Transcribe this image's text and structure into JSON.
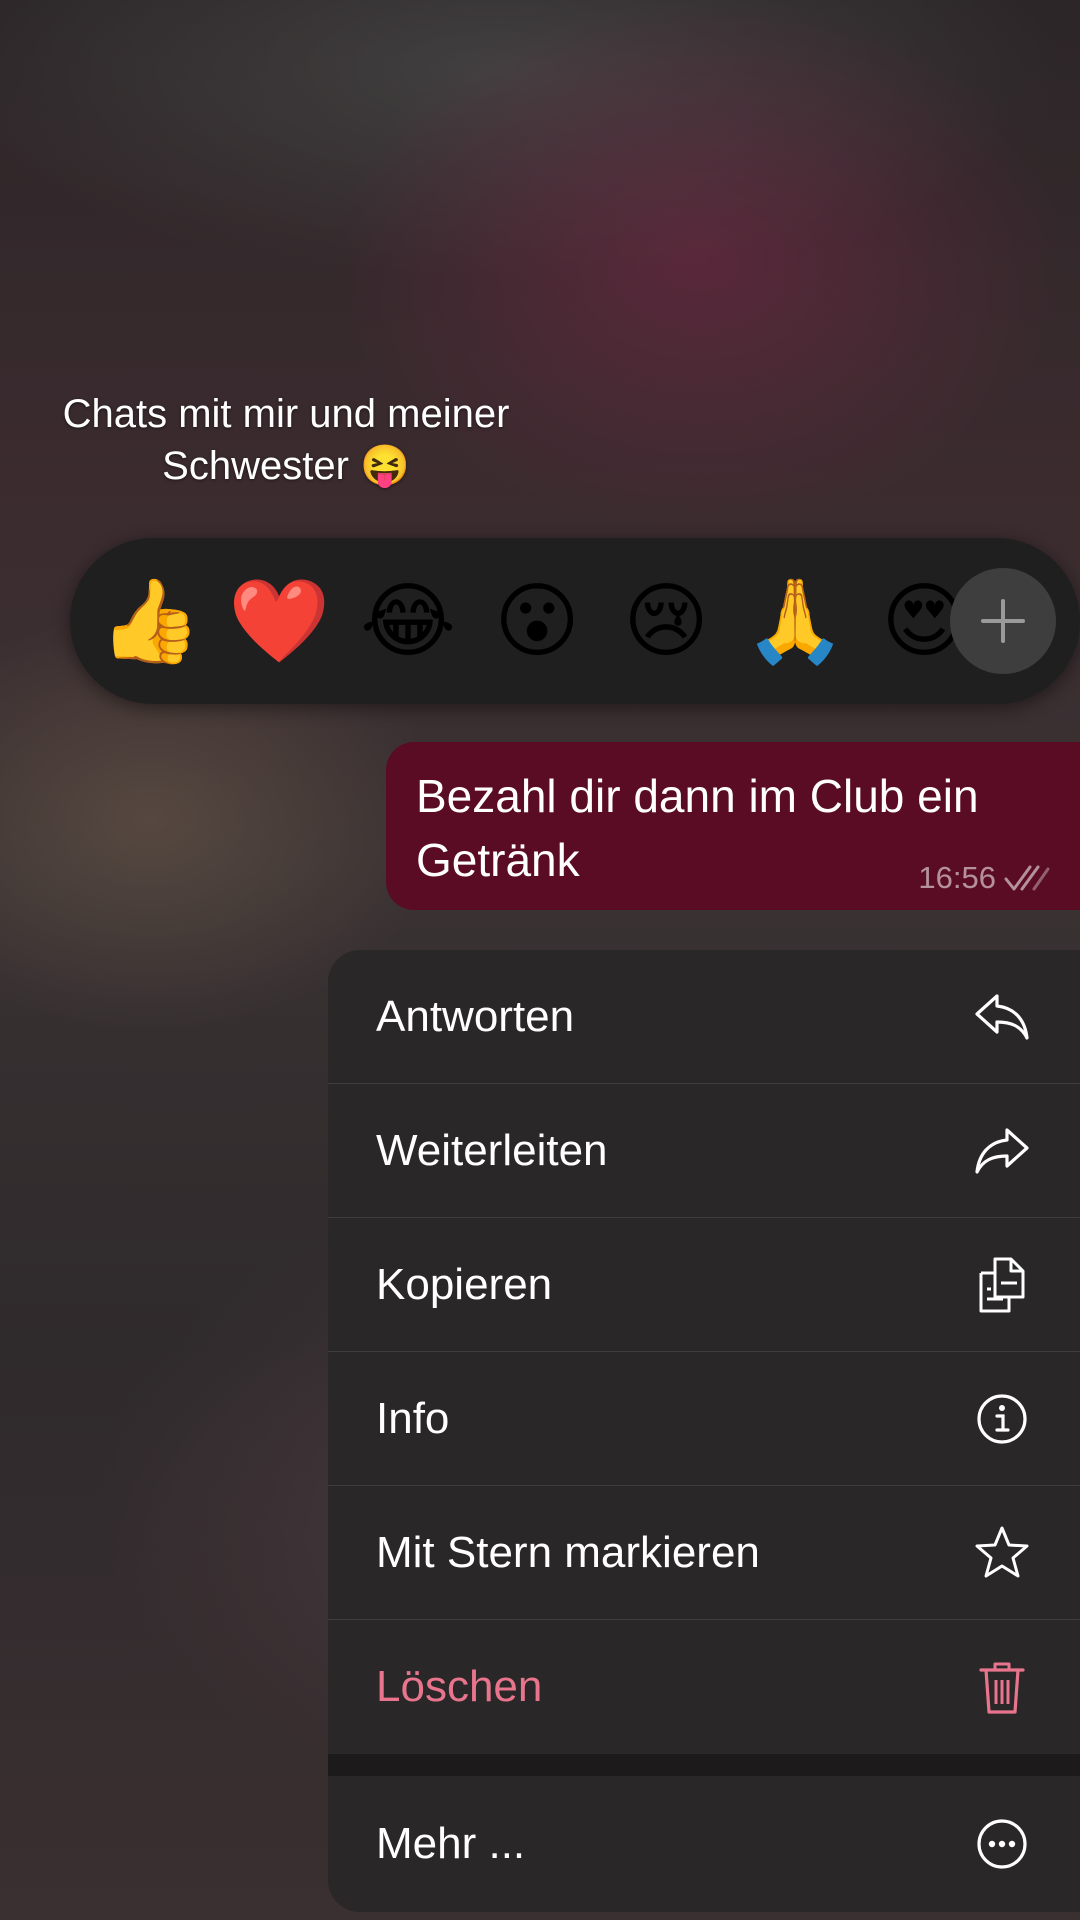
{
  "overlay": {
    "caption_line1": "Chats mit mir und meiner",
    "caption_line2": "Schwester 😝"
  },
  "reactions": {
    "emojis": [
      {
        "name": "thumbs-up",
        "glyph": "👍"
      },
      {
        "name": "red-heart",
        "glyph": "❤️"
      },
      {
        "name": "tears-of-joy",
        "glyph": "😂"
      },
      {
        "name": "surprised-face",
        "glyph": "😮"
      },
      {
        "name": "crying-face",
        "glyph": "😢"
      },
      {
        "name": "folded-hands",
        "glyph": "🙏"
      },
      {
        "name": "heart-eyes",
        "glyph": "😍"
      }
    ],
    "more_icon": "plus-icon"
  },
  "message": {
    "text": "Bezahl dir dann im Club ein Getränk",
    "time": "16:56",
    "status_icon": "double-check-icon",
    "bubble_color": "#5a0c24"
  },
  "context_menu": {
    "items": [
      {
        "label": "Antworten",
        "icon": "reply-icon"
      },
      {
        "label": "Weiterleiten",
        "icon": "forward-icon"
      },
      {
        "label": "Kopieren",
        "icon": "copy-icon"
      },
      {
        "label": "Info",
        "icon": "info-icon"
      },
      {
        "label": "Mit Stern markieren",
        "icon": "star-icon"
      },
      {
        "label": "Löschen",
        "icon": "trash-icon",
        "color": "#e8758d"
      }
    ],
    "more": {
      "label": "Mehr ...",
      "icon": "more-icon"
    }
  }
}
